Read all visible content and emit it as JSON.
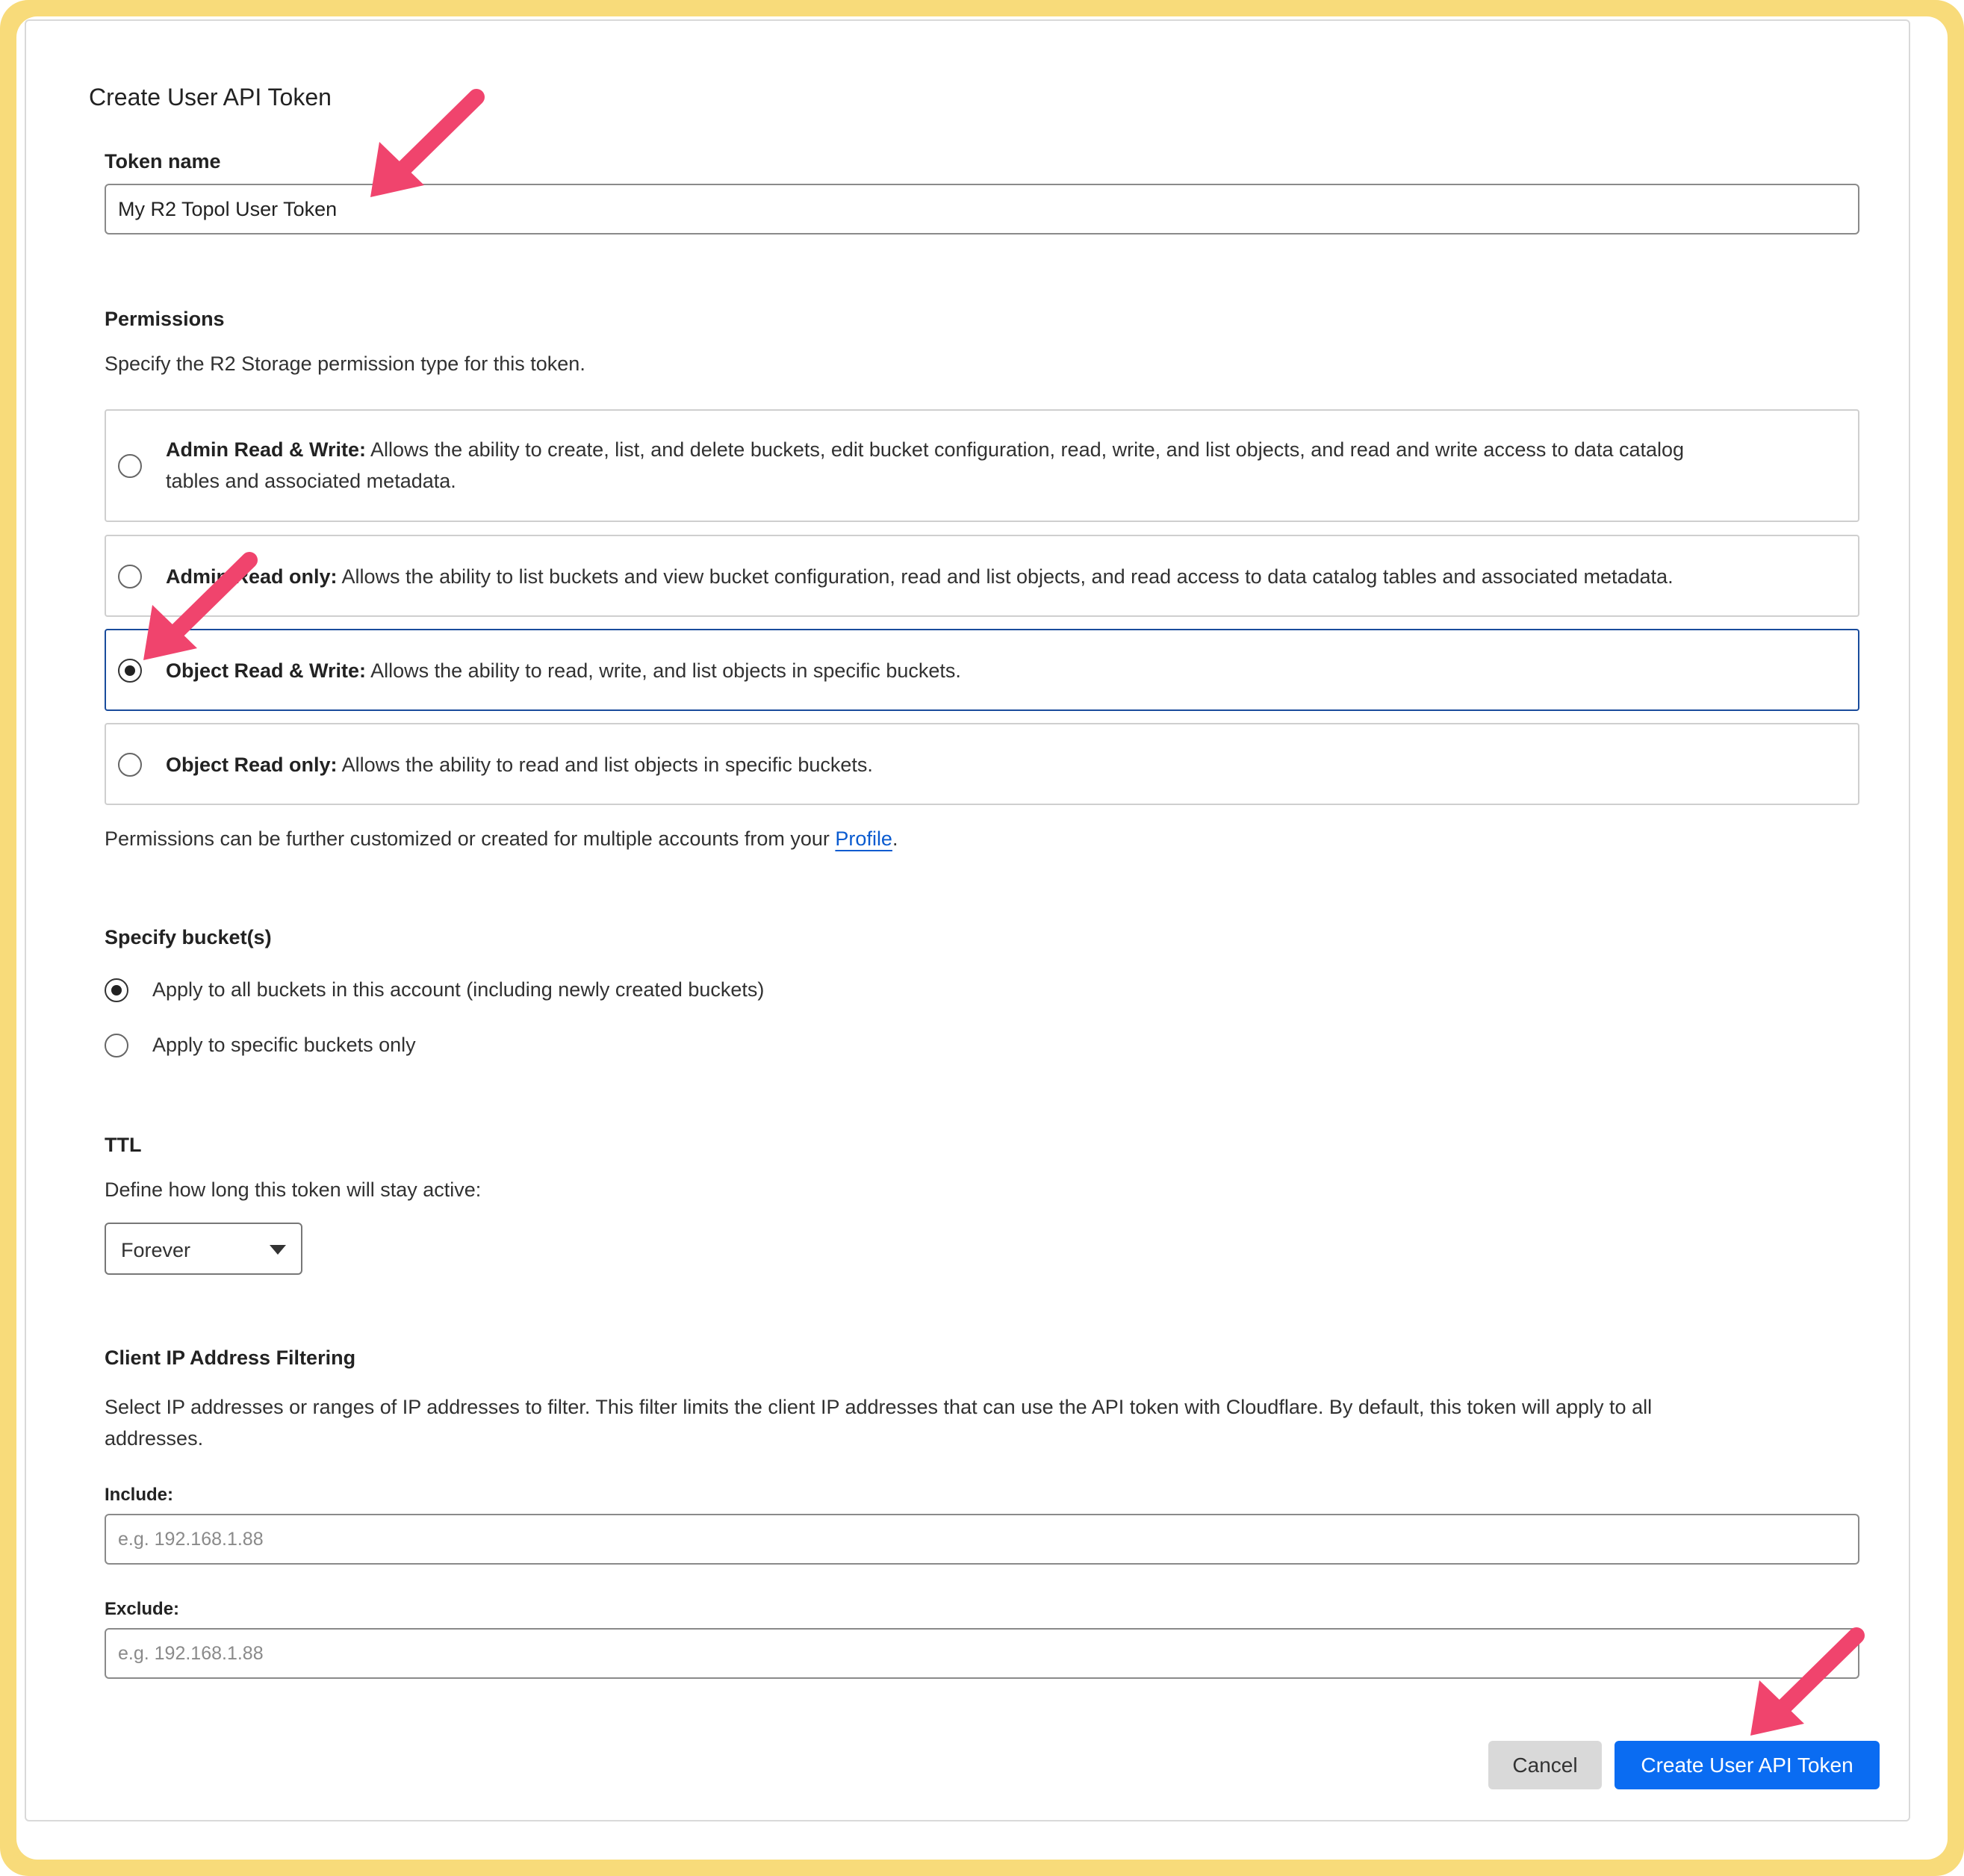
{
  "dialog": {
    "title": "Create User API Token"
  },
  "token_name": {
    "label": "Token name",
    "value": "My R2 Topol User Token"
  },
  "permissions": {
    "heading": "Permissions",
    "description": "Specify the R2 Storage permission type for this token.",
    "options": [
      {
        "name": "Admin Read & Write:",
        "desc_line1": "Allows the ability to create, list, and delete buckets, edit bucket configuration, read, write, and list objects, and read and write access to data catalog",
        "desc_line2": "tables and associated metadata.",
        "selected": false
      },
      {
        "name": "Admin Read only:",
        "desc": "Allows the ability to list buckets and view bucket configuration, read and list objects, and read access to data catalog tables and associated metadata.",
        "selected": false
      },
      {
        "name": "Object Read & Write:",
        "desc": "Allows the ability to read, write, and list objects in specific buckets.",
        "selected": true
      },
      {
        "name": "Object Read only:",
        "desc": "Allows the ability to read and list objects in specific buckets.",
        "selected": false
      }
    ],
    "footnote_prefix": "Permissions can be further customized or created for multiple accounts from your ",
    "footnote_link": "Profile",
    "footnote_suffix": "."
  },
  "buckets": {
    "heading": "Specify bucket(s)",
    "options": [
      {
        "label": "Apply to all buckets in this account (including newly created buckets)",
        "selected": true
      },
      {
        "label": "Apply to specific buckets only",
        "selected": false
      }
    ]
  },
  "ttl": {
    "heading": "TTL",
    "description": "Define how long this token will stay active:",
    "selected": "Forever"
  },
  "ip_filter": {
    "heading": "Client IP Address Filtering",
    "desc_line1": "Select IP addresses or ranges of IP addresses to filter. This filter limits the client IP addresses that can use the API token with Cloudflare. By default, this token will apply to all",
    "desc_line2": "addresses.",
    "include_label": "Include:",
    "include_placeholder": "e.g. 192.168.1.88",
    "exclude_label": "Exclude:",
    "exclude_placeholder": "e.g. 192.168.1.88"
  },
  "actions": {
    "cancel": "Cancel",
    "create": "Create User API Token"
  },
  "colors": {
    "frame": "#f8db7a",
    "primary": "#0a6cf2",
    "annotation_arrow": "#f0446d",
    "selected_border": "#1a4c9c"
  }
}
